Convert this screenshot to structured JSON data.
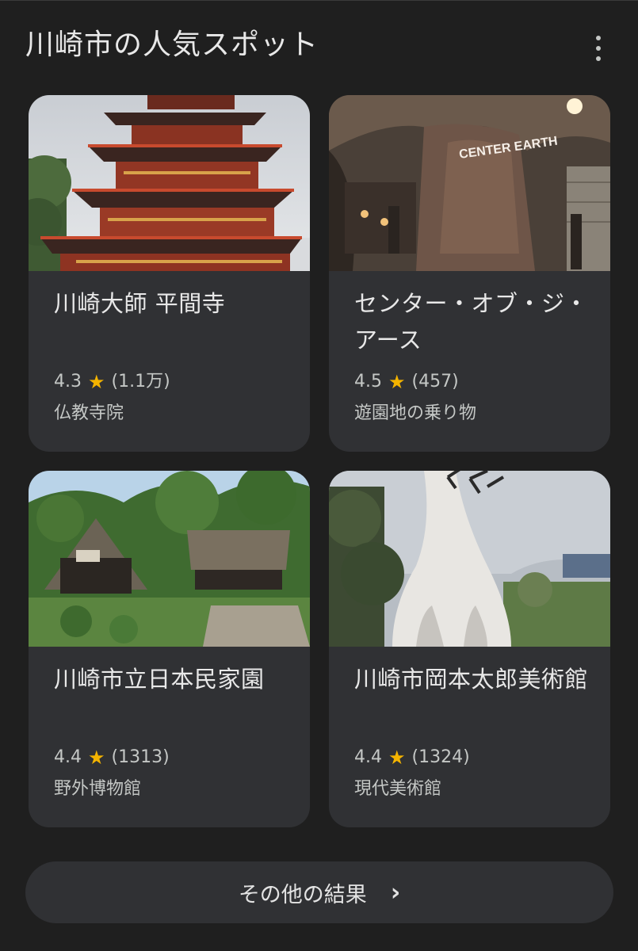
{
  "header": {
    "title": "川崎市の人気スポット",
    "menu_icon": "more-vert-icon"
  },
  "cards": [
    {
      "name": "川崎大師 平間寺",
      "rating": "4.3",
      "reviews": "(1.1万)",
      "category": "仏教寺院",
      "image": "pagoda-photo"
    },
    {
      "name": "センター・オブ・ジ・アース",
      "rating": "4.5",
      "reviews": "(457)",
      "category": "遊園地の乗り物",
      "image": "volcano-cave-photo",
      "sign_text": "CENTER EARTH"
    },
    {
      "name": "川崎市立日本民家園",
      "rating": "4.4",
      "reviews": "(1313)",
      "category": "野外博物館",
      "image": "thatched-houses-photo"
    },
    {
      "name": "川崎市岡本太郎美術館",
      "rating": "4.4",
      "reviews": "(1324)",
      "category": "現代美術館",
      "image": "white-sculpture-photo"
    }
  ],
  "footer": {
    "more_results_label": "その他の結果",
    "chevron_icon": "chevron-right-icon"
  },
  "colors": {
    "background": "#1f1f1f",
    "card": "#303134",
    "star": "#f4b400",
    "text_primary": "#e8e8e8",
    "text_secondary": "#c4c7c5"
  }
}
